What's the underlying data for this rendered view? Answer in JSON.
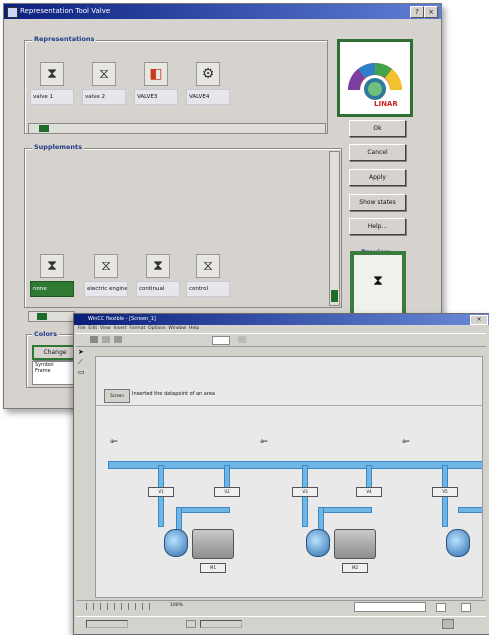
{
  "dialog": {
    "title": "Representation Tool Valve",
    "sections": {
      "representations": {
        "label": "Representations",
        "items": [
          {
            "label": "valve 1",
            "icon": "hourglass-icon"
          },
          {
            "label": "valve 2",
            "icon": "valve-icon"
          },
          {
            "label": "VALVE3",
            "icon": "valve-red-icon"
          },
          {
            "label": "VALVE4",
            "icon": "valve-gear-icon"
          }
        ]
      },
      "supplements": {
        "label": "Supplements",
        "items": [
          {
            "label": "none",
            "icon": "hourglass-icon",
            "selected": true
          },
          {
            "label": "electric engine",
            "icon": "electric-engine-icon"
          },
          {
            "label": "continual",
            "icon": "continual-icon"
          },
          {
            "label": "control",
            "icon": "control-icon"
          }
        ]
      },
      "colors": {
        "label": "Colors",
        "change_label": "Change",
        "list": [
          "Symbol",
          "Frame"
        ]
      },
      "preview": {
        "label": "Preview"
      }
    },
    "buttons": {
      "ok": "Ok",
      "cancel": "Cancel",
      "apply": "Apply",
      "show_states": "Show states",
      "help": "Help..."
    },
    "logo": {
      "text": "LINAR"
    }
  },
  "hmi": {
    "title": "WinCC flexible - [Screen_1]",
    "menu": [
      "File",
      "Edit",
      "View",
      "Insert",
      "Format",
      "Options",
      "Window",
      "Help"
    ],
    "banner_label": "Screen",
    "banner_text": "Inserted the datapoint of an area",
    "status": {
      "zoom": "100%",
      "field": "",
      "left": "",
      "coord": ""
    }
  },
  "colors": {
    "title_bar": "#0b1f7e",
    "selection_green": "#2f7a33",
    "pipe_blue": "#6fb6e6"
  }
}
